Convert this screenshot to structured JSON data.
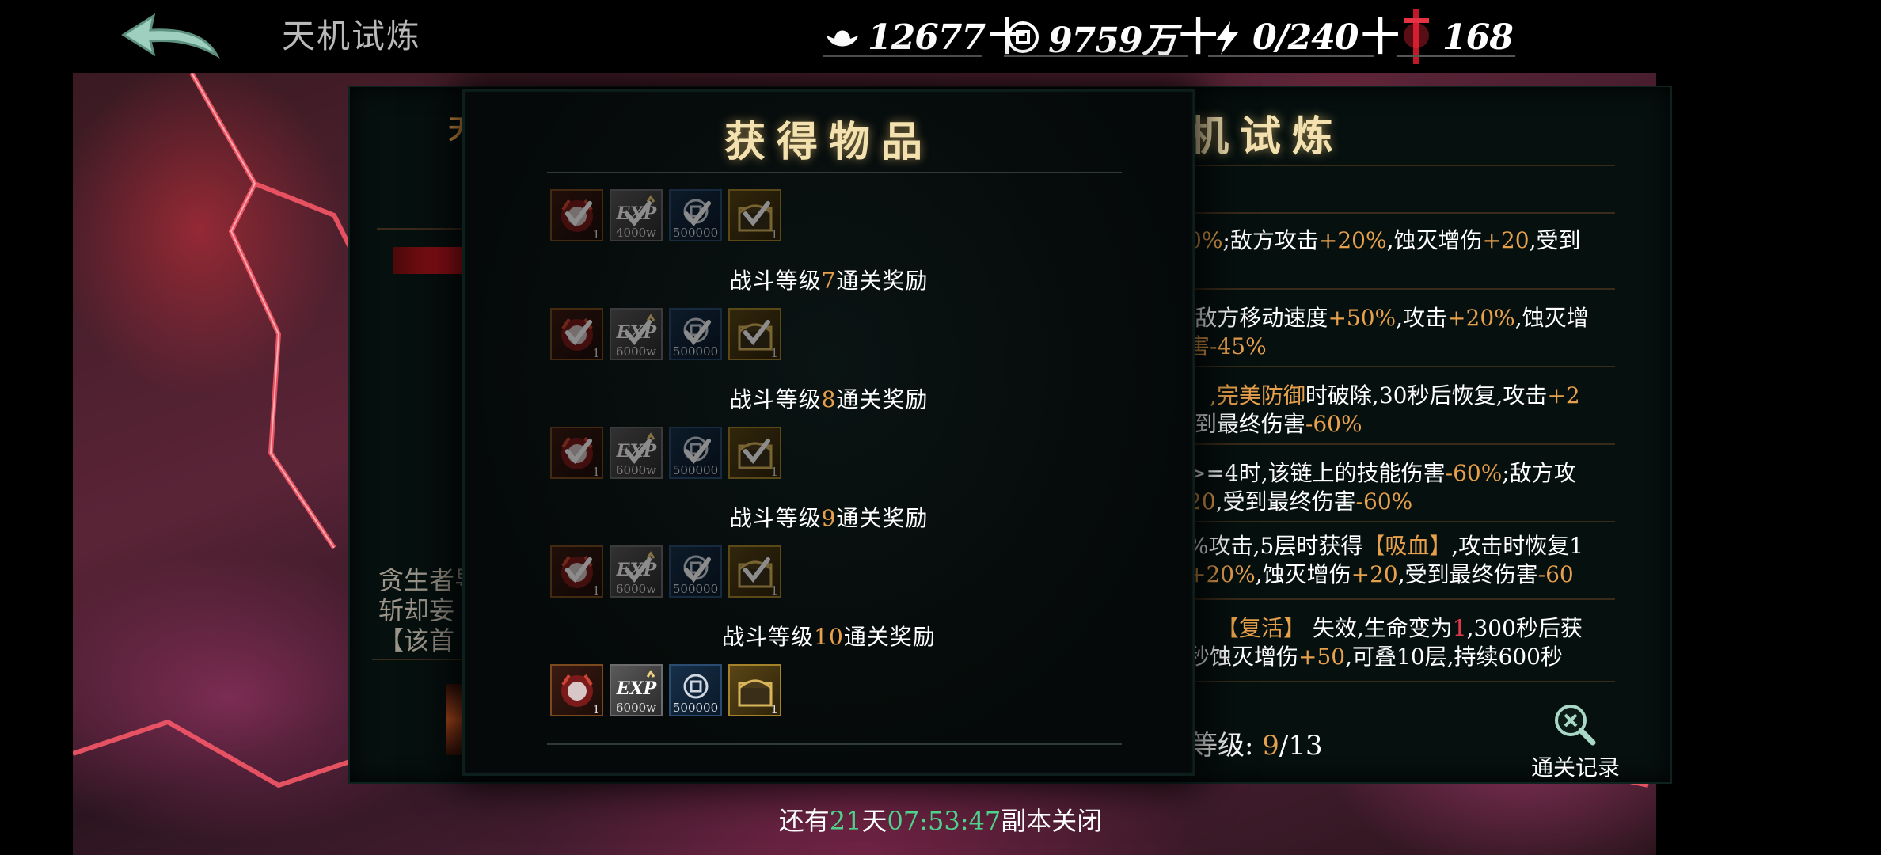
{
  "header": {
    "title": "天机试炼",
    "resources": [
      {
        "icon": "ingot-icon",
        "value": "12677",
        "plus": "十"
      },
      {
        "icon": "coin-icon",
        "value": "9759万",
        "plus": "十"
      },
      {
        "icon": "lightning-icon",
        "value": "0/240",
        "plus": "十"
      },
      {
        "icon": "sword-icon",
        "value": "168"
      }
    ]
  },
  "modal": {
    "title": "获得物品",
    "rewards": [
      {
        "items": [
          {
            "type": "mask",
            "count": "1"
          },
          {
            "type": "exp",
            "qty": "4000w"
          },
          {
            "type": "coin",
            "qty": "500000"
          },
          {
            "type": "chest",
            "count": "1"
          }
        ],
        "claimed": true
      },
      {
        "label_pre": "战斗等级",
        "level": "7",
        "label_post": "通关奖励",
        "items": [
          {
            "type": "mask",
            "count": "1"
          },
          {
            "type": "exp",
            "qty": "6000w"
          },
          {
            "type": "coin",
            "qty": "500000"
          },
          {
            "type": "chest",
            "count": "1"
          }
        ],
        "claimed": true
      },
      {
        "label_pre": "战斗等级",
        "level": "8",
        "label_post": "通关奖励",
        "items": [
          {
            "type": "mask",
            "count": "1"
          },
          {
            "type": "exp",
            "qty": "6000w"
          },
          {
            "type": "coin",
            "qty": "500000"
          },
          {
            "type": "chest",
            "count": "1"
          }
        ],
        "claimed": true
      },
      {
        "label_pre": "战斗等级",
        "level": "9",
        "label_post": "通关奖励",
        "items": [
          {
            "type": "mask",
            "count": "1"
          },
          {
            "type": "exp",
            "qty": "6000w"
          },
          {
            "type": "coin",
            "qty": "500000"
          },
          {
            "type": "chest",
            "count": "1"
          }
        ],
        "claimed": true
      },
      {
        "label_pre": "战斗等级",
        "level": "10",
        "label_post": "通关奖励",
        "items": [
          {
            "type": "mask",
            "count": "1"
          },
          {
            "type": "exp",
            "qty": "6000w"
          },
          {
            "type": "coin",
            "qty": "500000"
          },
          {
            "type": "chest",
            "count": "1"
          }
        ],
        "claimed": false
      }
    ]
  },
  "right_panel": {
    "title": "机试炼",
    "title_first_char": "天",
    "lines": [
      [
        {
          "t": "0%",
          "c": "o"
        },
        {
          "t": ";敌方攻击"
        },
        {
          "t": "+20%",
          "c": "o"
        },
        {
          "t": ",蚀灭增伤"
        },
        {
          "t": "+20",
          "c": "o"
        },
        {
          "t": ",受到"
        }
      ],
      [
        {
          "t": ";敌方移动速度"
        },
        {
          "t": "+50%",
          "c": "o"
        },
        {
          "t": ",攻击"
        },
        {
          "t": "+20%",
          "c": "o"
        },
        {
          "t": ",蚀灭增"
        }
      ],
      [
        {
          "t": "害",
          "c": "o"
        },
        {
          "t": "-45%",
          "c": "o"
        }
      ],
      [
        {
          "t": "】",
          "c": "r"
        },
        {
          "t": ",完美防御",
          "c": "o"
        },
        {
          "t": "时破除,30秒后恢复,攻击"
        },
        {
          "t": "+2",
          "c": "o"
        }
      ],
      [
        {
          "t": ",到最终伤害"
        },
        {
          "t": "-60%",
          "c": "o"
        }
      ],
      [
        {
          "t": ">=4时,该链上的技能伤害"
        },
        {
          "t": "-60%",
          "c": "o"
        },
        {
          "t": ";敌方攻"
        }
      ],
      [
        {
          "t": "20",
          "c": "o"
        },
        {
          "t": ",受到最终伤害"
        },
        {
          "t": "-60%",
          "c": "o"
        }
      ],
      [
        {
          "t": "%攻击,5层时获得"
        },
        {
          "t": "【吸血】",
          "c": "o"
        },
        {
          "t": ",攻击时恢复1"
        }
      ],
      [
        {
          "t": "+20%",
          "c": "o"
        },
        {
          "t": ",蚀灭增伤"
        },
        {
          "t": "+20",
          "c": "o"
        },
        {
          "t": ",受到最终伤害"
        },
        {
          "t": "-60",
          "c": "o"
        }
      ],
      [
        {
          "t": "】 ",
          "c": "o"
        },
        {
          "t": "【复活】",
          "c": "o"
        },
        {
          "t": " 失效,生命变为"
        },
        {
          "t": "1",
          "c": "r"
        },
        {
          "t": ",300秒后获"
        }
      ],
      [
        {
          "t": "秒蚀灭增伤"
        },
        {
          "t": "+50",
          "c": "o"
        },
        {
          "t": ",可叠10层,持续600秒"
        }
      ]
    ],
    "level_label": "等级:",
    "level_current": "9",
    "level_total": "/13",
    "record_label": "通关记录"
  },
  "left_panel": {
    "lines": [
      "贪生者导",
      "斩却妄",
      "【该首"
    ]
  },
  "timer": {
    "pre": "还有",
    "days": "21",
    "day_unit": "天",
    "time": "07:53:47",
    "post": "副本关闭"
  },
  "colors": {
    "accent_orange": "#e7a04c",
    "accent_red": "#e0384a",
    "accent_green": "#4fd38c",
    "title_gold": "#f3e1b0"
  }
}
